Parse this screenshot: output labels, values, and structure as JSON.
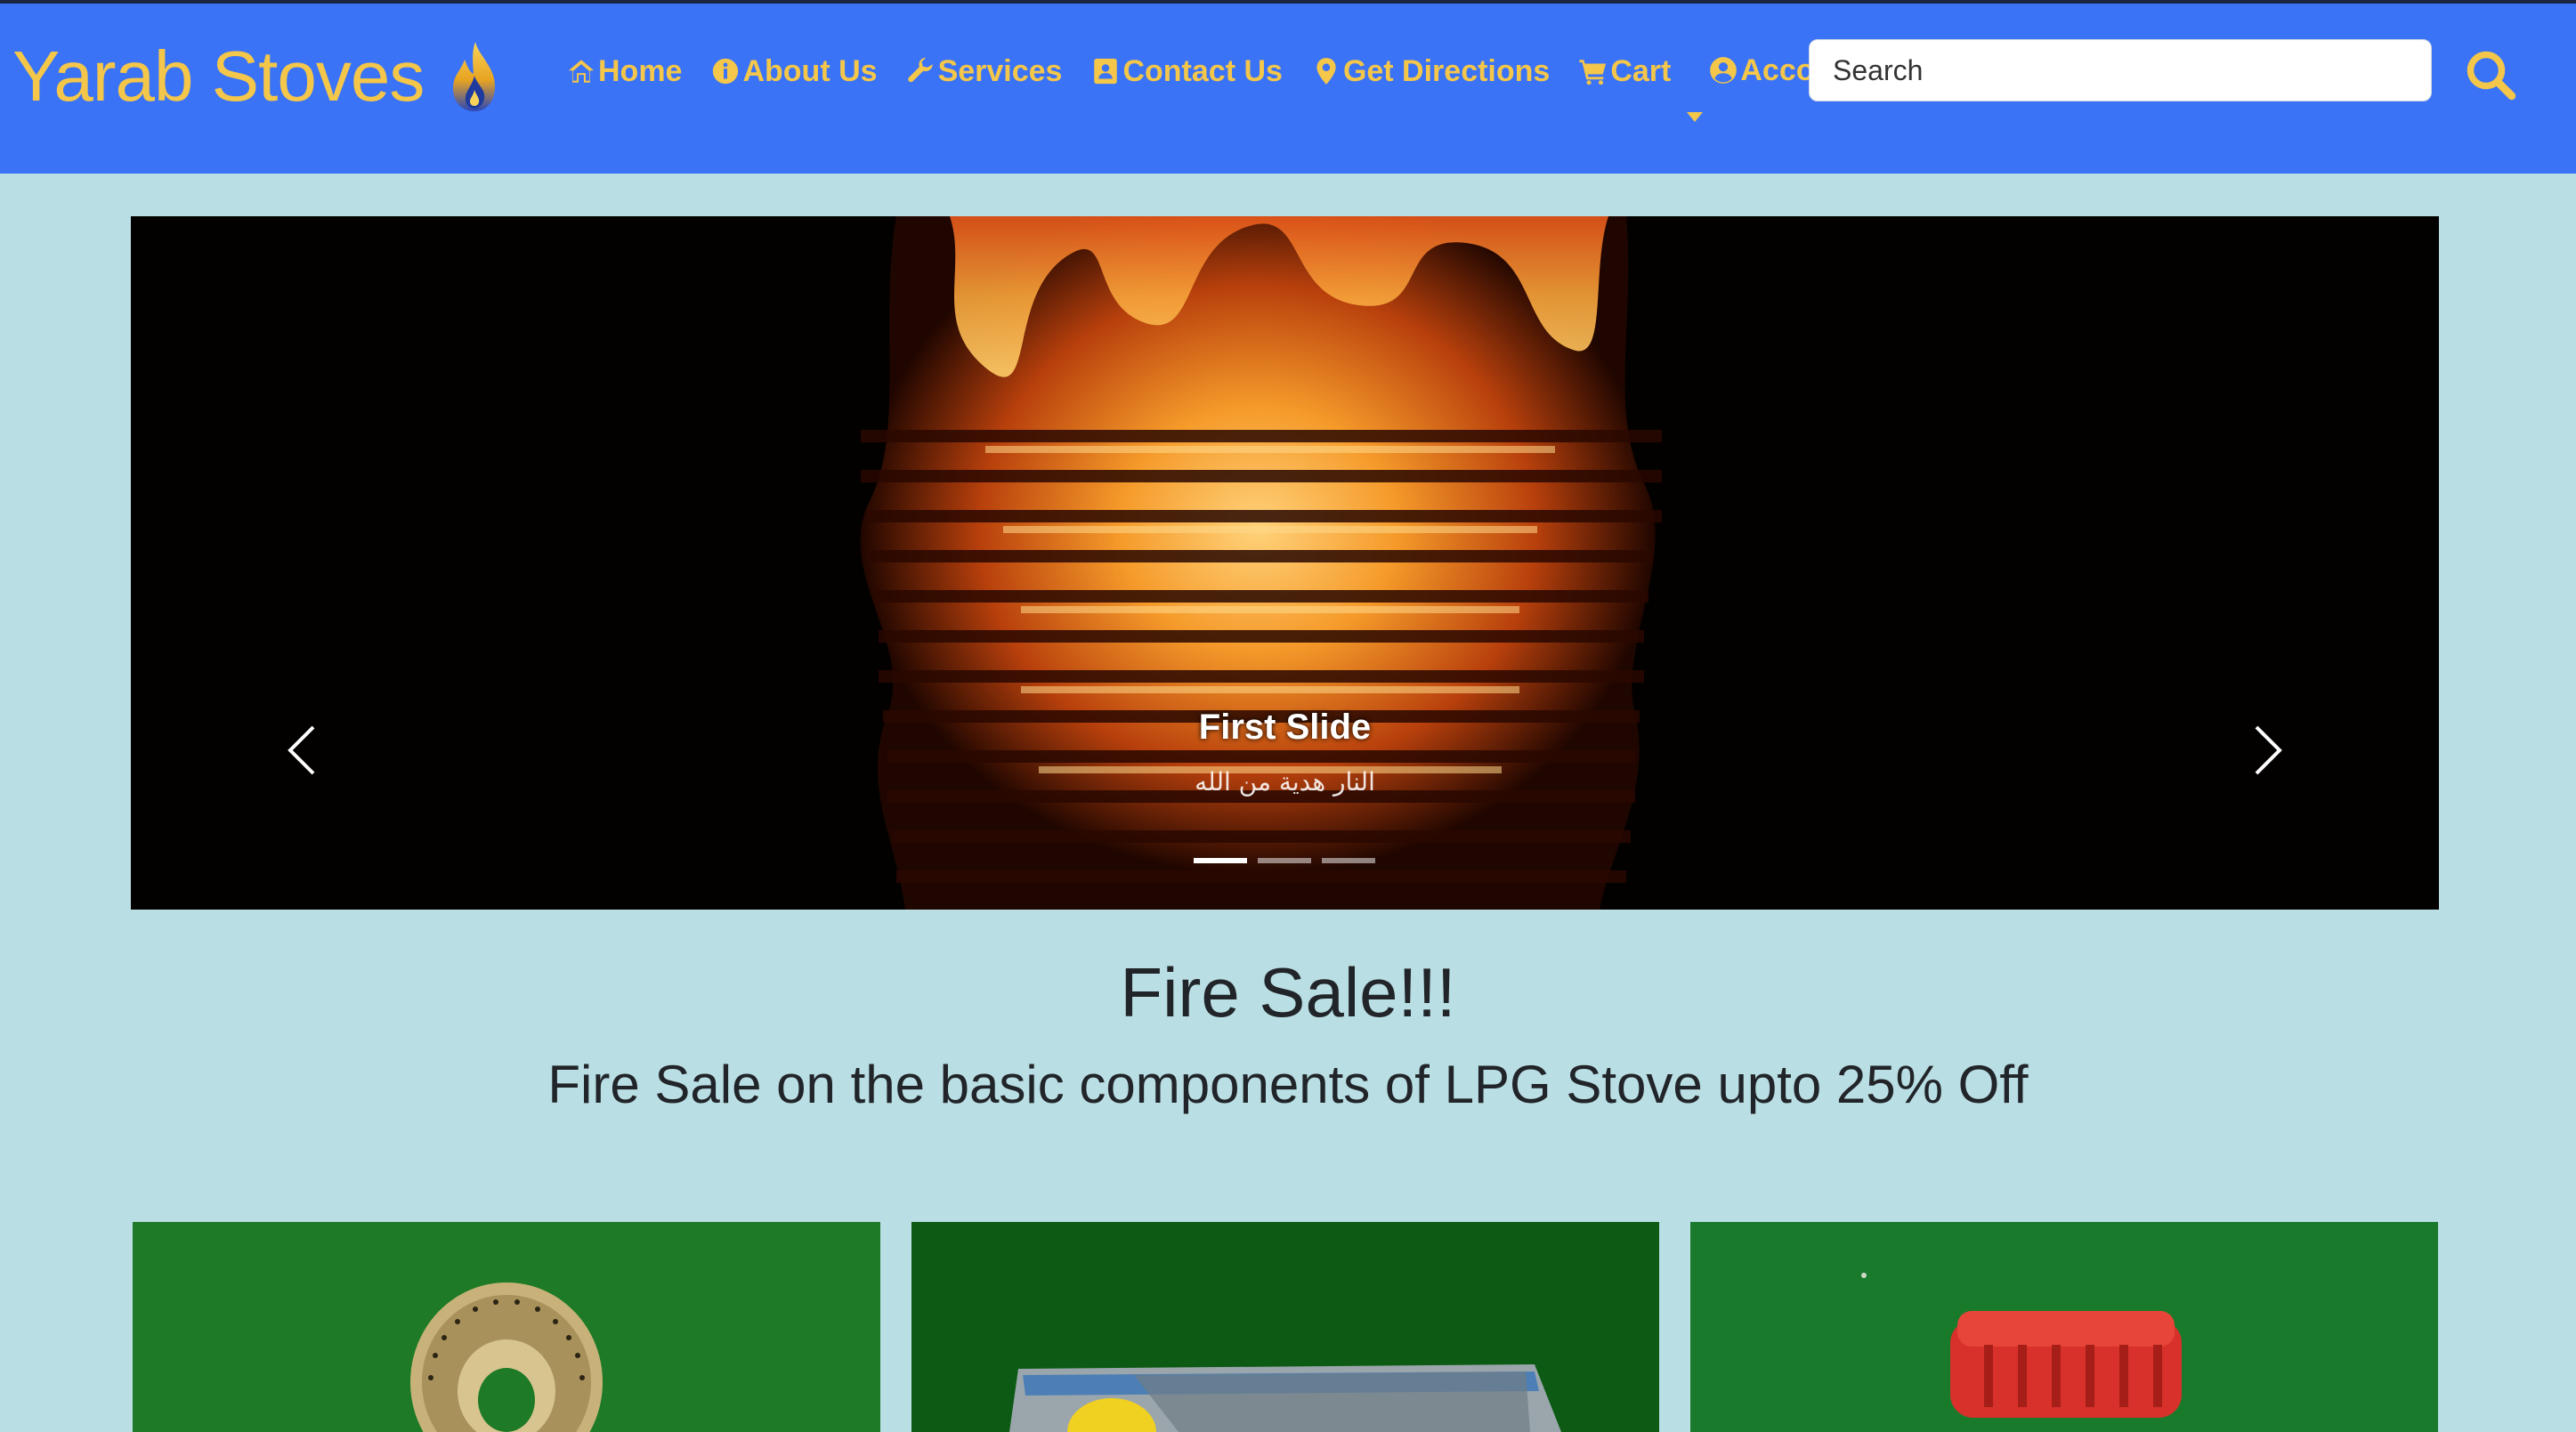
{
  "brand": {
    "name": "Yarab Stoves",
    "logo_icon": "flame-icon"
  },
  "nav": [
    {
      "label": "Home",
      "icon": "home-icon"
    },
    {
      "label": "About Us",
      "icon": "info-icon"
    },
    {
      "label": "Services",
      "icon": "wrench-icon"
    },
    {
      "label": "Contact Us",
      "icon": "contact-card-icon"
    },
    {
      "label": "Get Directions",
      "icon": "map-pin-icon"
    },
    {
      "label": "Cart",
      "icon": "cart-icon"
    },
    {
      "label": "Account",
      "icon": "user-circle-icon"
    }
  ],
  "search": {
    "placeholder": "Search",
    "icon": "search-icon"
  },
  "carousel": {
    "caption_title": "First Slide",
    "caption_subtitle": "النار هدية من الله",
    "indicator_count": 3,
    "active_index": 0
  },
  "sale": {
    "title": "Fire Sale!!!",
    "subtitle": "Fire Sale on the basic components of LPG Stove upto 25% Off"
  },
  "colors": {
    "navbar_bg": "#3a73f5",
    "accent_gold": "#f4c64a",
    "page_bg": "#b9dee4",
    "card_green": "#1b6e23"
  }
}
